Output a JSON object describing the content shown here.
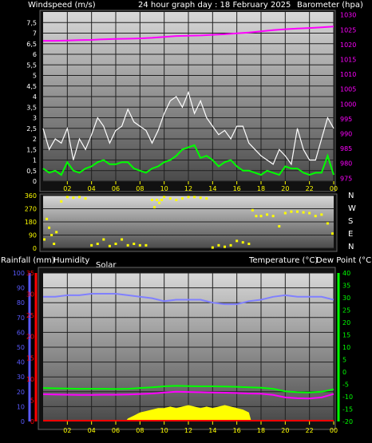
{
  "header": {
    "left_label": "Windspeed (m/s)",
    "title": "24 hour graph day : 18 February 2025",
    "right_label": "Barometer (hpa)"
  },
  "mid_panel": {
    "compass": [
      "N",
      "W",
      "S",
      "E",
      "N"
    ]
  },
  "bottom_header": {
    "rain_label": "Rainfall (mm)",
    "humidity_label": "Humidity",
    "solar_label": "Solar",
    "temp_label": "Temperature (°C)",
    "dew_label": "Dew Point (°C)"
  },
  "colors": {
    "background": "#000000",
    "plot_top": "#d8d8d8",
    "plot_bottom": "#4a4a4a",
    "windspeed": "#ffffff",
    "wind_avg": "#00ff00",
    "barometer": "#ff00ff",
    "direction": "#ffff00",
    "humidity": "#8080ff",
    "temperature": "#00ff00",
    "dewpoint": "#ff00ff",
    "solar": "#ffff00",
    "rain_axis": "#ff0000",
    "humidity_axis": "#5a5aff",
    "temp_axis": "#00ff00",
    "grid": "#202020",
    "hour_tick": "#ffff00"
  },
  "chart_data": [
    {
      "type": "line",
      "name": "wind-barometer",
      "title": "24 hour graph day : 18 February 2025",
      "ylabel": "Windspeed (m/s)",
      "y2label": "Barometer (hpa)",
      "ylim": [
        0,
        8
      ],
      "y2lim": [
        974,
        1031
      ],
      "y_ticks": [
        "0",
        "0,5",
        "1",
        "1,5",
        "2",
        "2,5",
        "3",
        "3,5",
        "4",
        "4,5",
        "5",
        "5,5",
        "6",
        "6,5",
        "7",
        "7,5"
      ],
      "y2_ticks": [
        "975",
        "980",
        "985",
        "990",
        "995",
        "1000",
        "1005",
        "1010",
        "1015",
        "1020",
        "1025",
        "1030"
      ],
      "x_ticks": [
        "02",
        "04",
        "06",
        "08",
        "10",
        "12",
        "14",
        "16",
        "18",
        "20",
        "22",
        "00"
      ],
      "grid": true,
      "series": [
        {
          "name": "Windspeed",
          "axis": "left",
          "x": [
            0,
            0.5,
            1,
            1.5,
            2,
            2.5,
            3,
            3.5,
            4,
            4.5,
            5,
            5.5,
            6,
            6.5,
            7,
            7.5,
            8,
            8.5,
            9,
            9.5,
            10,
            10.5,
            11,
            11.5,
            12,
            12.5,
            13,
            13.5,
            14,
            14.5,
            15,
            15.5,
            16,
            16.5,
            17,
            17.5,
            18,
            18.5,
            19,
            19.5,
            20,
            20.5,
            21,
            21.5,
            22,
            22.5,
            23,
            23.5,
            24
          ],
          "values": [
            2.5,
            1.5,
            2,
            1.8,
            2.5,
            1,
            2,
            1.5,
            2.2,
            3,
            2.6,
            1.8,
            2.4,
            2.6,
            3.4,
            2.8,
            2.6,
            2.4,
            1.8,
            2.4,
            3.2,
            3.8,
            4,
            3.5,
            4.2,
            3.2,
            3.8,
            3,
            2.6,
            2.2,
            2.4,
            2,
            2.6,
            2.6,
            1.8,
            1.5,
            1.2,
            1,
            0.8,
            1.5,
            1.2,
            0.8,
            2.5,
            1.5,
            1,
            1,
            2,
            3,
            2.5
          ]
        },
        {
          "name": "Wind average",
          "axis": "left",
          "x": [
            0,
            0.5,
            1,
            1.5,
            2,
            2.5,
            3,
            3.5,
            4,
            4.5,
            5,
            5.5,
            6,
            6.5,
            7,
            7.5,
            8,
            8.5,
            9,
            9.5,
            10,
            10.5,
            11,
            11.5,
            12,
            12.5,
            13,
            13.5,
            14,
            14.5,
            15,
            15.5,
            16,
            16.5,
            17,
            17.5,
            18,
            18.5,
            19,
            19.5,
            20,
            20.5,
            21,
            21.5,
            22,
            22.5,
            23,
            23.5,
            24
          ],
          "values": [
            0.6,
            0.4,
            0.5,
            0.3,
            0.9,
            0.5,
            0.4,
            0.6,
            0.7,
            0.9,
            1,
            0.8,
            0.8,
            0.9,
            0.9,
            0.6,
            0.5,
            0.4,
            0.6,
            0.7,
            0.9,
            1,
            1.2,
            1.5,
            1.6,
            1.7,
            1.1,
            1.2,
            1,
            0.7,
            0.9,
            1,
            0.7,
            0.5,
            0.5,
            0.4,
            0.3,
            0.5,
            0.4,
            0.3,
            0.7,
            0.6,
            0.6,
            0.4,
            0.3,
            0.4,
            0.4,
            1.2,
            0.3
          ]
        },
        {
          "name": "Barometer",
          "axis": "right",
          "x": [
            0,
            1,
            2,
            3,
            4,
            5,
            6,
            7,
            8,
            9,
            10,
            11,
            12,
            13,
            14,
            15,
            16,
            17,
            18,
            19,
            20,
            21,
            22,
            23,
            24
          ],
          "values": [
            1021.3,
            1021.3,
            1021.4,
            1021.5,
            1021.6,
            1021.8,
            1021.9,
            1022.0,
            1022.1,
            1022.3,
            1022.6,
            1022.9,
            1023.0,
            1023.1,
            1023.3,
            1023.5,
            1023.8,
            1024.1,
            1024.5,
            1024.9,
            1025.2,
            1025.4,
            1025.6,
            1025.8,
            1026.1
          ]
        }
      ]
    },
    {
      "type": "scatter",
      "name": "wind-direction",
      "ylabel": "",
      "ylim": [
        0,
        360
      ],
      "y_ticks": [
        "0",
        "90",
        "180",
        "270",
        "360"
      ],
      "grid": true,
      "series": [
        {
          "name": "Direction",
          "x": [
            0.1,
            0.3,
            0.5,
            0.7,
            0.9,
            1.1,
            1.5,
            2,
            2.5,
            3,
            3.5,
            4,
            4.5,
            5,
            5.5,
            6,
            6.5,
            7,
            7.5,
            8,
            8.5,
            9,
            9.2,
            9.4,
            9.6,
            9.8,
            10,
            10.5,
            11,
            11.5,
            12,
            12.5,
            13,
            13.5,
            14,
            14.5,
            15,
            15.5,
            16,
            16.5,
            17,
            17.3,
            17.6,
            18,
            18.5,
            19,
            19.5,
            20,
            20.5,
            21,
            21.5,
            22,
            22.5,
            23,
            23.5,
            23.9
          ],
          "values": [
            60,
            200,
            140,
            90,
            30,
            110,
            320,
            350,
            345,
            350,
            340,
            20,
            30,
            60,
            15,
            30,
            60,
            20,
            30,
            20,
            20,
            330,
            280,
            330,
            310,
            330,
            350,
            340,
            330,
            340,
            350,
            350,
            345,
            340,
            5,
            20,
            10,
            20,
            50,
            40,
            30,
            260,
            220,
            220,
            230,
            220,
            150,
            240,
            250,
            250,
            245,
            240,
            220,
            230,
            170,
            100
          ]
        }
      ]
    },
    {
      "type": "line",
      "name": "humidity-temperature-solar",
      "ylabel": "Rainfall (mm)",
      "y2label": "Temperature (°C)",
      "ylim": [
        0,
        100
      ],
      "y2lim": [
        -20,
        40
      ],
      "rain_ticks": [
        "0",
        "5",
        "10",
        "15",
        "20",
        "25",
        "30",
        "35"
      ],
      "humidity_ticks": [
        "0",
        "10",
        "20",
        "30",
        "40",
        "50",
        "60",
        "70",
        "80",
        "90",
        "100"
      ],
      "temp_ticks": [
        "-20",
        "-15",
        "-10",
        "-5",
        "0",
        "5",
        "10",
        "15",
        "20",
        "25",
        "30",
        "35",
        "40"
      ],
      "x_ticks": [
        "02",
        "04",
        "06",
        "08",
        "10",
        "12",
        "14",
        "16",
        "18",
        "20",
        "22",
        "00"
      ],
      "grid": true,
      "series": [
        {
          "name": "Humidity",
          "axis": "humidity",
          "x": [
            0,
            1,
            2,
            3,
            4,
            5,
            6,
            7,
            8,
            9,
            10,
            11,
            12,
            13,
            14,
            15,
            16,
            17,
            18,
            19,
            20,
            21,
            22,
            23,
            24
          ],
          "values": [
            84,
            84,
            85,
            85,
            86,
            86,
            86,
            85,
            84,
            83,
            81,
            82,
            82,
            82,
            80,
            79,
            79,
            81,
            82,
            84,
            85,
            84,
            84,
            84,
            82
          ]
        },
        {
          "name": "Temperature",
          "axis": "temp",
          "x": [
            0,
            1,
            2,
            3,
            4,
            5,
            6,
            7,
            8,
            9,
            10,
            11,
            12,
            13,
            14,
            15,
            16,
            17,
            18,
            19,
            20,
            21,
            22,
            23,
            24
          ],
          "values": [
            -6.5,
            -6.6,
            -6.7,
            -6.8,
            -6.8,
            -6.8,
            -6.9,
            -6.8,
            -6.5,
            -6.2,
            -5.8,
            -5.6,
            -5.7,
            -5.8,
            -5.8,
            -5.9,
            -6.0,
            -6.2,
            -6.4,
            -6.8,
            -7.8,
            -8.2,
            -8.3,
            -8.0,
            -7.0
          ]
        },
        {
          "name": "Dew Point",
          "axis": "temp",
          "x": [
            0,
            1,
            2,
            3,
            4,
            5,
            6,
            7,
            8,
            9,
            10,
            11,
            12,
            13,
            14,
            15,
            16,
            17,
            18,
            19,
            20,
            21,
            22,
            23,
            24
          ],
          "values": [
            -9.0,
            -9.1,
            -9.2,
            -9.3,
            -9.3,
            -9.2,
            -9.2,
            -9.1,
            -8.9,
            -8.7,
            -8.3,
            -8.0,
            -8.1,
            -8.2,
            -8.3,
            -8.4,
            -8.5,
            -8.7,
            -8.8,
            -9.3,
            -10.3,
            -10.6,
            -10.7,
            -10.3,
            -8.9
          ]
        },
        {
          "name": "Solar",
          "axis": "solar",
          "x": [
            0,
            6.8,
            7,
            7.5,
            8,
            8.5,
            9,
            9.5,
            10,
            10.5,
            11,
            11.5,
            12,
            12.5,
            13,
            13.5,
            14,
            14.5,
            15,
            15.5,
            16,
            16.5,
            17,
            17.2,
            24
          ],
          "values": [
            0,
            0,
            2,
            4,
            6,
            7,
            8,
            9,
            9,
            10,
            9,
            10,
            11,
            10,
            9,
            10,
            9,
            10,
            11,
            10,
            9,
            8,
            6,
            0,
            0
          ]
        }
      ]
    }
  ]
}
